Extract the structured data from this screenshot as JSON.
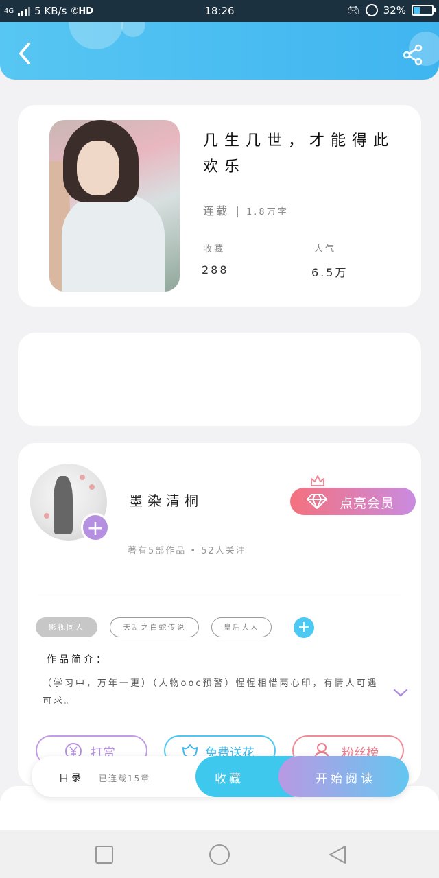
{
  "status_bar": {
    "network": "4G",
    "speed": "5 KB/s",
    "hd": "HD",
    "time": "18:26",
    "battery": "32%"
  },
  "icons": {
    "back": "chevron-left-icon",
    "share": "share-icon",
    "vip": "diamond-icon",
    "crown": "crown-icon",
    "reward": "yen-icon",
    "flower": "flower-icon",
    "fans": "person-icon",
    "expand": "chevron-down-icon"
  },
  "book": {
    "title": "几生几世，才能得此欢乐",
    "status": "连载",
    "word_count": "1.8万字",
    "favorites_label": "收藏",
    "favorites_value": "288",
    "popularity_label": "人气",
    "popularity_value": "6.5万"
  },
  "author": {
    "name": "墨染清桐",
    "meta": "著有5部作品 • 52人关注",
    "vip_button": "点亮会员"
  },
  "tags": [
    "影视同人",
    "天乱之白蛇传说",
    "皇后大人"
  ],
  "intro": {
    "title": "作品简介：",
    "text": "（学习中，万年一更）（人物ooc预警）惺惺相惜两心印，有情人可遇可求。"
  },
  "actions": {
    "reward": "打赏",
    "flower": "免费送花",
    "fans": "粉丝榜"
  },
  "bottom_bar": {
    "toc": "目录",
    "serial": "已连载15章",
    "favorite": "收藏",
    "read": "开始阅读"
  },
  "colors": {
    "header": "#4fbff2",
    "vip_gradient_start": "#f4717e",
    "vip_gradient_end": "#c98be0",
    "accent_blue": "#3fc8ee",
    "accent_purple": "#b58fe0"
  }
}
